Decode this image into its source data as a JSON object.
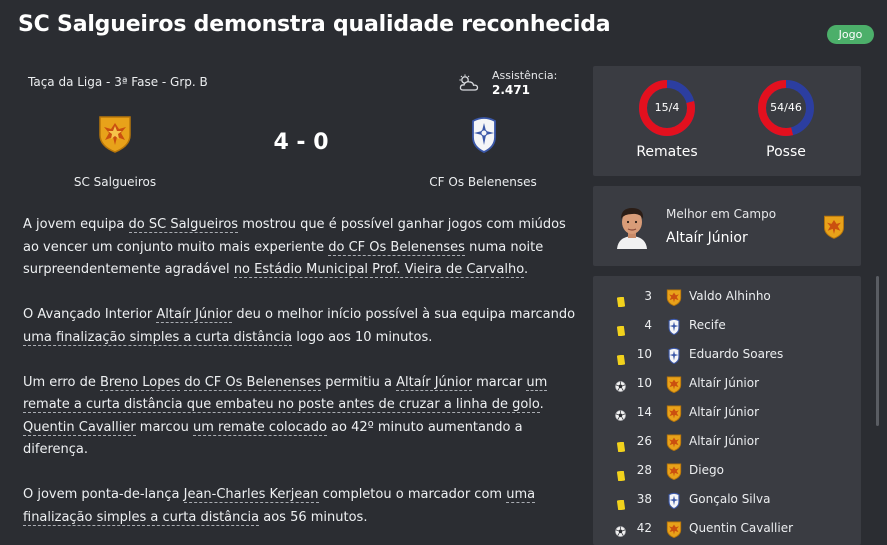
{
  "header": {
    "title": "SC Salgueiros demonstra qualidade reconhecida",
    "badge": "Jogo"
  },
  "match": {
    "competition": "Taça da Liga - 3ª Fase - Grp. B",
    "attendance_label": "Assistência:",
    "attendance_value": "2.471",
    "weather_icon": "cloudy-sun-icon",
    "score": "4 - 0",
    "home_team": "SC Salgueiros",
    "away_team": "CF Os Belenenses",
    "home_color": "#e8a21a",
    "away_color": "#3a57a8"
  },
  "article": [
    [
      {
        "t": "A jovem equipa "
      },
      {
        "t": "do SC Salgueiros",
        "u": true
      },
      {
        "t": " mostrou que é possível ganhar jogos com miúdos ao vencer um conjunto muito mais experiente "
      },
      {
        "t": "do CF Os Belenenses",
        "u": true
      },
      {
        "t": " numa noite surpreendentemente agradável "
      },
      {
        "t": "no Estádio Municipal Prof. Vieira de Carvalho",
        "u": true
      },
      {
        "t": "."
      }
    ],
    [
      {
        "t": "O Avançado Interior "
      },
      {
        "t": "Altaír Júnior",
        "u": true
      },
      {
        "t": " deu o melhor início possível à sua equipa marcando "
      },
      {
        "t": "uma finalização simples a curta distância",
        "u": true
      },
      {
        "t": " logo aos 10 minutos."
      }
    ],
    [
      {
        "t": "Um erro de "
      },
      {
        "t": "Breno Lopes",
        "u": true
      },
      {
        "t": " "
      },
      {
        "t": "do CF Os Belenenses",
        "u": true
      },
      {
        "t": " permitiu a "
      },
      {
        "t": "Altaír Júnior",
        "u": true
      },
      {
        "t": " marcar "
      },
      {
        "t": "um remate a curta distância que embateu no poste antes de cruzar a linha de golo",
        "u": true
      },
      {
        "t": ". "
      },
      {
        "t": "Quentin Cavallier",
        "u": true
      },
      {
        "t": " marcou "
      },
      {
        "t": "um remate colocado",
        "u": true
      },
      {
        "t": " ao 42º minuto aumentando a diferença."
      }
    ],
    [
      {
        "t": "O jovem ponta-de-lança "
      },
      {
        "t": "Jean-Charles Kerjean",
        "u": true
      },
      {
        "t": " completou o marcador com "
      },
      {
        "t": "uma finalização simples a curta distância",
        "u": true
      },
      {
        "t": " aos 56 minutos."
      }
    ]
  ],
  "stats": [
    {
      "label": "15/4",
      "caption": "Remates",
      "home": 15,
      "away": 4
    },
    {
      "label": "54/46",
      "caption": "Posse",
      "home": 54,
      "away": 46
    }
  ],
  "stat_colors": {
    "home": "#e3101e",
    "away": "#2c3ea0"
  },
  "motm": {
    "label": "Melhor em Campo",
    "name": "Altaír Júnior"
  },
  "events": [
    {
      "type": "yellow-card",
      "minute": "3",
      "team": "home",
      "player": "Valdo Alhinho"
    },
    {
      "type": "yellow-card",
      "minute": "4",
      "team": "away",
      "player": "Recife"
    },
    {
      "type": "yellow-card",
      "minute": "10",
      "team": "away",
      "player": "Eduardo Soares"
    },
    {
      "type": "goal",
      "minute": "10",
      "team": "home",
      "player": "Altaír Júnior"
    },
    {
      "type": "goal",
      "minute": "14",
      "team": "home",
      "player": "Altaír Júnior"
    },
    {
      "type": "yellow-card",
      "minute": "26",
      "team": "home",
      "player": "Altaír Júnior"
    },
    {
      "type": "yellow-card",
      "minute": "28",
      "team": "home",
      "player": "Diego"
    },
    {
      "type": "yellow-card",
      "minute": "38",
      "team": "away",
      "player": "Gonçalo Silva"
    },
    {
      "type": "goal",
      "minute": "42",
      "team": "home",
      "player": "Quentin Cavallier"
    }
  ]
}
